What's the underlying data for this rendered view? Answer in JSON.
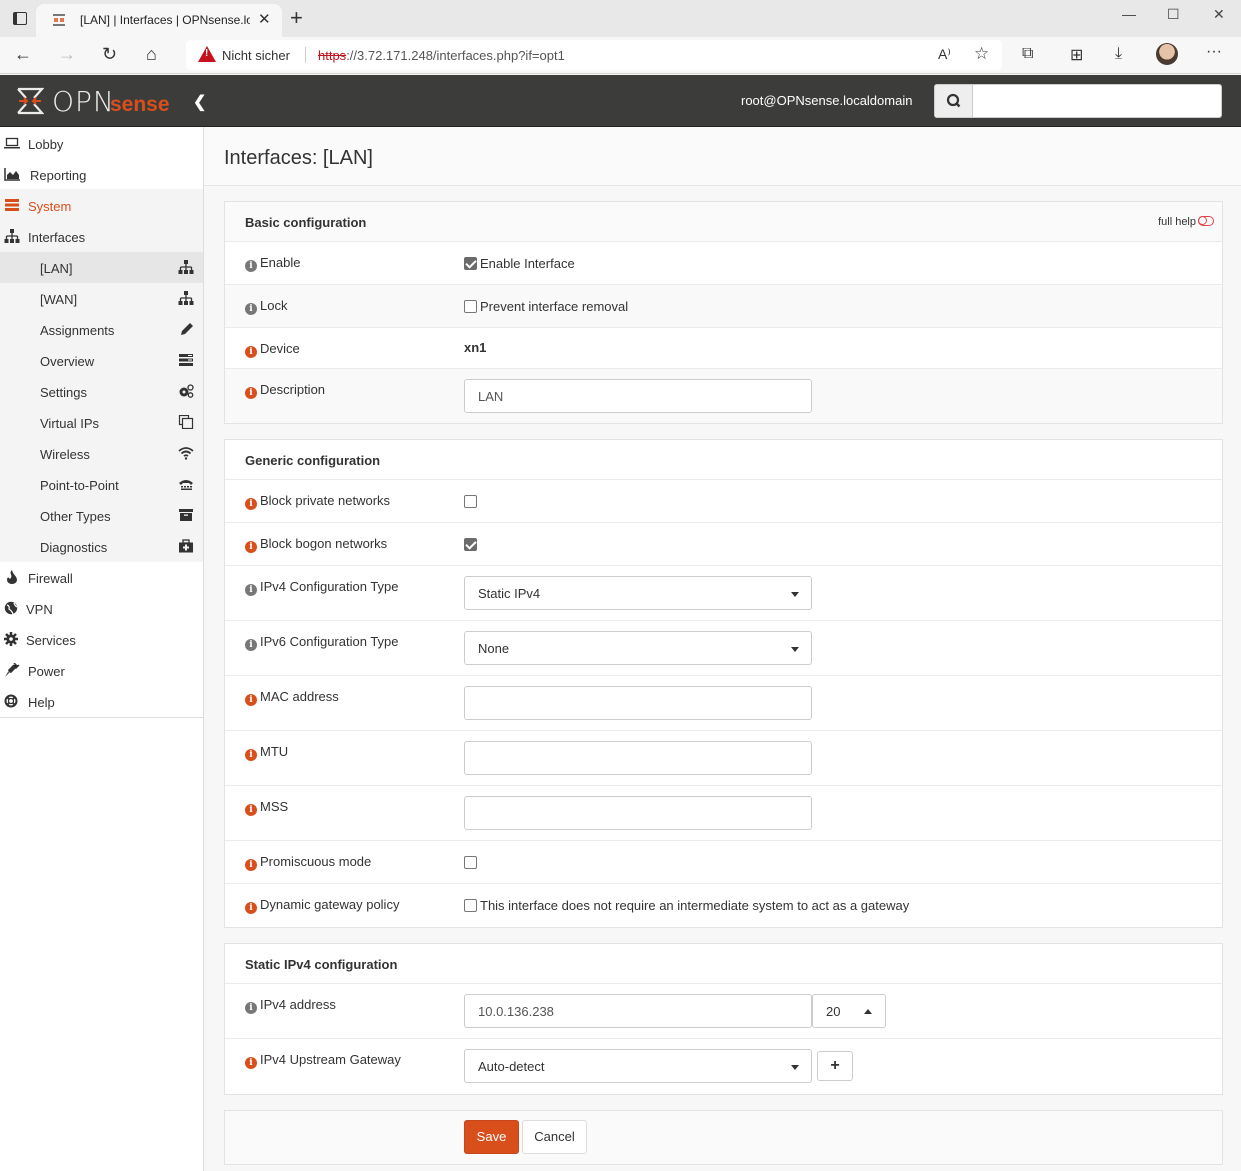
{
  "browser": {
    "tab_title": "[LAN] | Interfaces | OPNsense.localdomain",
    "security_label": "Nicht sicher",
    "url_protocol": "https",
    "url_rest": "://3.72.171.248/interfaces.php?if=opt1",
    "icons": {
      "window": "window-icon",
      "favicon": "opnsense-favicon",
      "close": "close-icon",
      "new_tab": "plus-icon",
      "back": "arrow-left-icon",
      "forward": "arrow-right-icon",
      "reload": "reload-icon",
      "home": "home-icon",
      "read_aloud": "read-aloud-icon",
      "favorite": "star-add-icon",
      "extensions": "puzzle-icon",
      "collections": "collections-icon",
      "downloads": "download-icon",
      "profile": "profile-avatar",
      "more": "more-icon"
    },
    "glyphs": {
      "close": "✕",
      "new_tab": "+",
      "back": "←",
      "forward": "→",
      "reload": "↻",
      "home": "⌂",
      "read_aloud": "A⁾",
      "favorite": "☆",
      "extensions": "⧉",
      "collections": "⊞",
      "downloads": "⤓",
      "more": "···",
      "minimize": "—",
      "maximize": "☐",
      "window_close": "✕"
    }
  },
  "header": {
    "logo_opn": "OPN",
    "logo_sense": "sense",
    "collapse_glyph": "❮",
    "user": "root@OPNsense.localdomain",
    "search_placeholder": "",
    "search_glyph": "🔍"
  },
  "sidebar": {
    "items": [
      {
        "label": "Lobby",
        "icon": "laptop-icon",
        "glyph": "▭"
      },
      {
        "label": "Reporting",
        "icon": "area-chart-icon",
        "glyph": "◣"
      },
      {
        "label": "System",
        "icon": "server-icon",
        "glyph": "☰",
        "active": true
      },
      {
        "label": "Interfaces",
        "icon": "sitemap-icon",
        "glyph": "⚯"
      },
      {
        "label": "Firewall",
        "icon": "fire-icon",
        "glyph": "♨"
      },
      {
        "label": "VPN",
        "icon": "globe-icon",
        "glyph": "◉"
      },
      {
        "label": "Services",
        "icon": "cog-icon",
        "glyph": "✹"
      },
      {
        "label": "Power",
        "icon": "plug-icon",
        "glyph": "✎"
      },
      {
        "label": "Help",
        "icon": "life-ring-icon",
        "glyph": "⊕"
      }
    ],
    "interfaces_sub": [
      {
        "label": "[LAN]",
        "icon": "sitemap-icon",
        "glyph": "⚯",
        "current": true
      },
      {
        "label": "[WAN]",
        "icon": "sitemap-icon",
        "glyph": "⚯"
      },
      {
        "label": "Assignments",
        "icon": "pencil-icon",
        "glyph": "✎"
      },
      {
        "label": "Overview",
        "icon": "tasks-icon",
        "glyph": "☰"
      },
      {
        "label": "Settings",
        "icon": "cogs-icon",
        "glyph": "⚙"
      },
      {
        "label": "Virtual IPs",
        "icon": "clone-icon",
        "glyph": "⧉"
      },
      {
        "label": "Wireless",
        "icon": "wifi-icon",
        "glyph": "≋"
      },
      {
        "label": "Point-to-Point",
        "icon": "tty-icon",
        "glyph": "☎"
      },
      {
        "label": "Other Types",
        "icon": "archive-icon",
        "glyph": "▤"
      },
      {
        "label": "Diagnostics",
        "icon": "medkit-icon",
        "glyph": "⊞"
      }
    ]
  },
  "page": {
    "title": "Interfaces: [LAN]"
  },
  "basic": {
    "title": "Basic configuration",
    "full_help": "full help",
    "full_help_enabled": false,
    "enable": {
      "label": "Enable",
      "checkbox_label": "Enable Interface",
      "checked": true
    },
    "lock": {
      "label": "Lock",
      "checkbox_label": "Prevent interface removal",
      "checked": false
    },
    "device": {
      "label": "Device",
      "value": "xn1"
    },
    "description": {
      "label": "Description",
      "value": "LAN"
    }
  },
  "generic": {
    "title": "Generic configuration",
    "block_private": {
      "label": "Block private networks",
      "checked": false
    },
    "block_bogon": {
      "label": "Block bogon networks",
      "checked": true
    },
    "ipv4_type": {
      "label": "IPv4 Configuration Type",
      "value": "Static IPv4"
    },
    "ipv6_type": {
      "label": "IPv6 Configuration Type",
      "value": "None"
    },
    "mac": {
      "label": "MAC address",
      "value": ""
    },
    "mtu": {
      "label": "MTU",
      "value": ""
    },
    "mss": {
      "label": "MSS",
      "value": ""
    },
    "promiscuous": {
      "label": "Promiscuous mode",
      "checked": false
    },
    "dyn_gw": {
      "label": "Dynamic gateway policy",
      "checkbox_label": "This interface does not require an intermediate system to act as a gateway",
      "checked": false
    }
  },
  "static_ipv4": {
    "title": "Static IPv4 configuration",
    "address": {
      "label": "IPv4 address",
      "value": "10.0.136.238",
      "subnet": "20"
    },
    "gateway": {
      "label": "IPv4 Upstream Gateway",
      "value": "Auto-detect",
      "add_glyph": "+"
    }
  },
  "actions": {
    "save": "Save",
    "cancel": "Cancel"
  },
  "colors": {
    "brand": "#d94f1b",
    "header_bg": "#3c3c3b",
    "info_grey": "#777777"
  }
}
